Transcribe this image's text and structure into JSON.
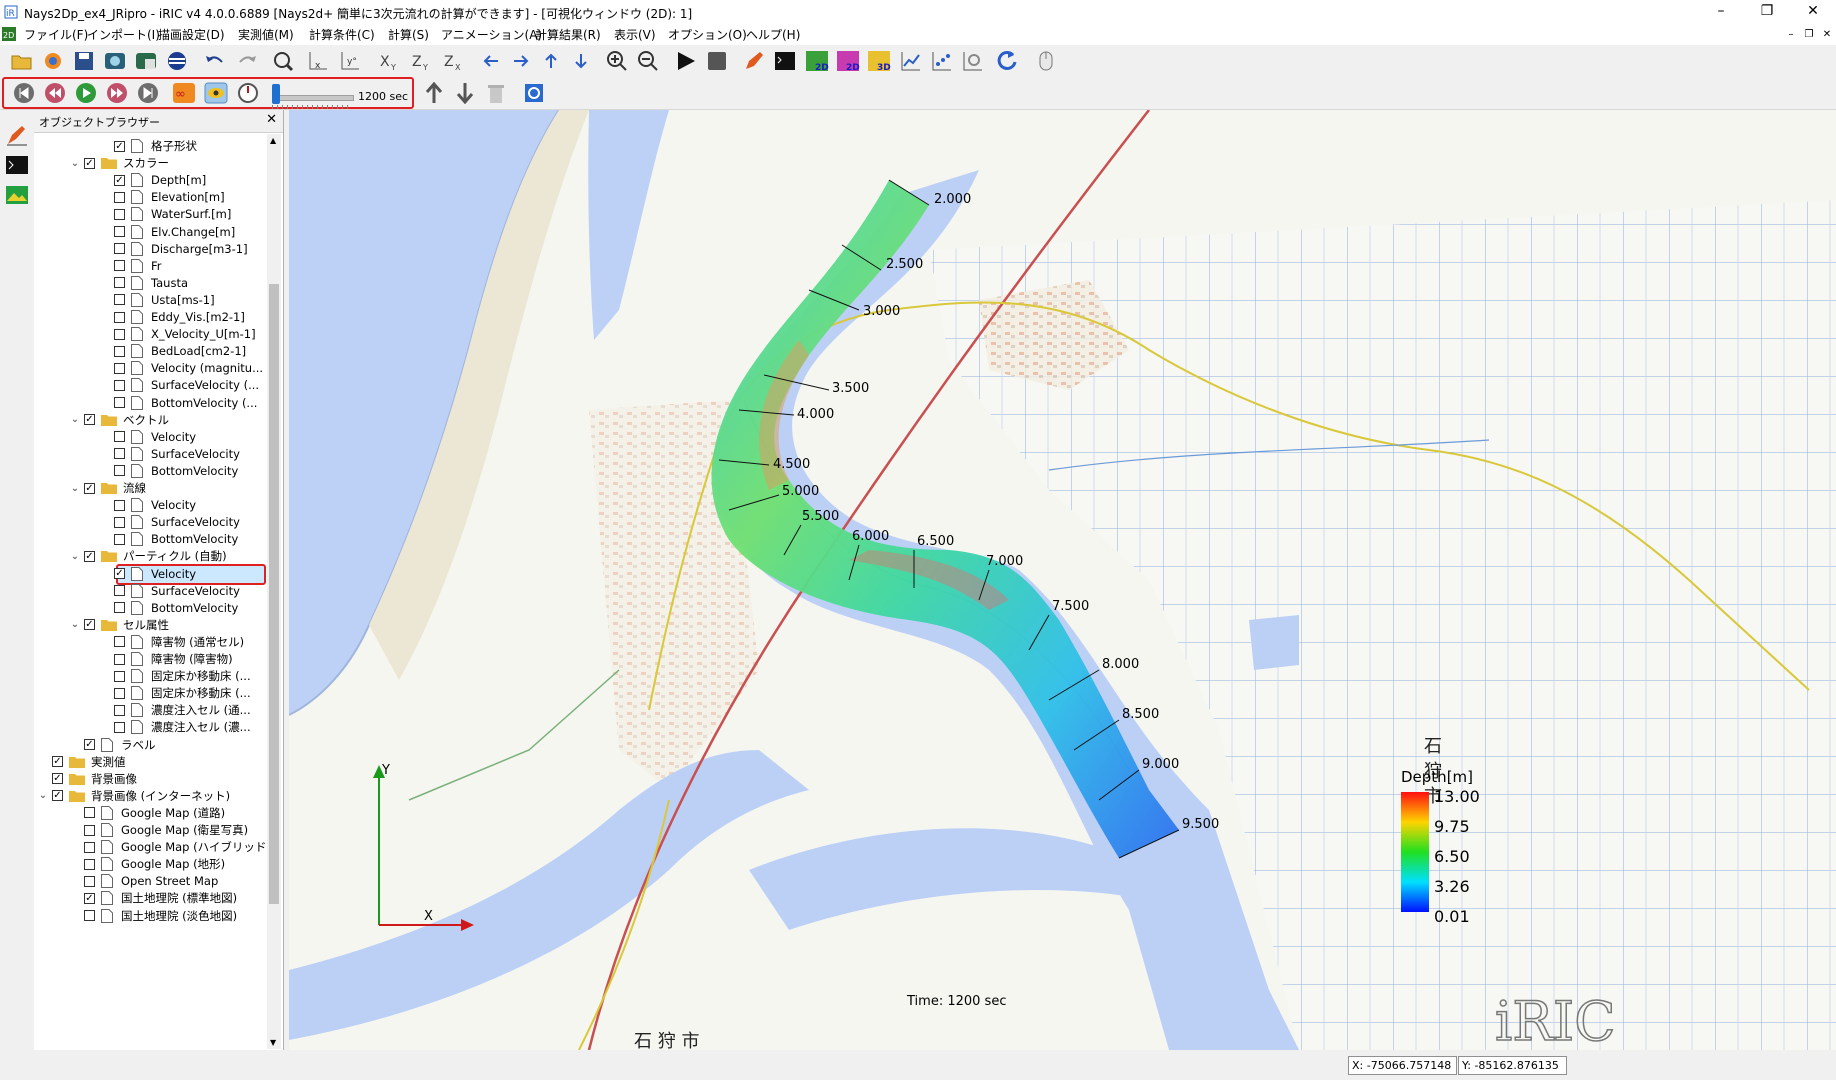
{
  "window": {
    "title": "Nays2Dp_ex4_JRipro - iRIC v4 4.0.0.6889 [Nays2d+ 簡単に3次元流れの計算ができます] - [可視化ウィンドウ (2D): 1]",
    "minimize": "–",
    "restore": "❐",
    "close": "✕"
  },
  "menu": [
    "ファイル(F)",
    "インポート(I)",
    "描画設定(D)",
    "実測値(M)",
    "計算条件(C)",
    "計算(S)",
    "アニメーション(A)",
    "計算結果(R)",
    "表示(V)",
    "オプション(O)",
    "ヘルプ(H)"
  ],
  "animation": {
    "time_label": "1200 sec",
    "progress": 0.02
  },
  "browser": {
    "title": "オブジェクトブラウザー",
    "close": "✕",
    "items": [
      {
        "label": "格子形状",
        "checked": true,
        "type": "file",
        "indent": 2,
        "expand": ""
      },
      {
        "label": "スカラー",
        "checked": true,
        "type": "folder",
        "indent": 1,
        "expand": "v"
      },
      {
        "label": "Depth[m]",
        "checked": true,
        "type": "file",
        "indent": 2,
        "expand": ""
      },
      {
        "label": "Elevation[m]",
        "checked": false,
        "type": "file",
        "indent": 2,
        "expand": ""
      },
      {
        "label": "WaterSurf.[m]",
        "checked": false,
        "type": "file",
        "indent": 2,
        "expand": ""
      },
      {
        "label": "Elv.Change[m]",
        "checked": false,
        "type": "file",
        "indent": 2,
        "expand": ""
      },
      {
        "label": "Discharge[m3-1]",
        "checked": false,
        "type": "file",
        "indent": 2,
        "expand": ""
      },
      {
        "label": "Fr",
        "checked": false,
        "type": "file",
        "indent": 2,
        "expand": ""
      },
      {
        "label": "Tausta",
        "checked": false,
        "type": "file",
        "indent": 2,
        "expand": ""
      },
      {
        "label": "Usta[ms-1]",
        "checked": false,
        "type": "file",
        "indent": 2,
        "expand": ""
      },
      {
        "label": "Eddy_Vis.[m2-1]",
        "checked": false,
        "type": "file",
        "indent": 2,
        "expand": ""
      },
      {
        "label": "X_Velocity_U[m-1]",
        "checked": false,
        "type": "file",
        "indent": 2,
        "expand": ""
      },
      {
        "label": "BedLoad[cm2-1]",
        "checked": false,
        "type": "file",
        "indent": 2,
        "expand": ""
      },
      {
        "label": "Velocity (magnitu...",
        "checked": false,
        "type": "file",
        "indent": 2,
        "expand": ""
      },
      {
        "label": "SurfaceVelocity (...",
        "checked": false,
        "type": "file",
        "indent": 2,
        "expand": ""
      },
      {
        "label": "BottomVelocity (...",
        "checked": false,
        "type": "file",
        "indent": 2,
        "expand": ""
      },
      {
        "label": "ベクトル",
        "checked": true,
        "type": "folder",
        "indent": 1,
        "expand": "v"
      },
      {
        "label": "Velocity",
        "checked": false,
        "type": "file",
        "indent": 2,
        "expand": ""
      },
      {
        "label": "SurfaceVelocity",
        "checked": false,
        "type": "file",
        "indent": 2,
        "expand": ""
      },
      {
        "label": "BottomVelocity",
        "checked": false,
        "type": "file",
        "indent": 2,
        "expand": ""
      },
      {
        "label": "流線",
        "checked": true,
        "type": "folder",
        "indent": 1,
        "expand": "v"
      },
      {
        "label": "Velocity",
        "checked": false,
        "type": "file",
        "indent": 2,
        "expand": ""
      },
      {
        "label": "SurfaceVelocity",
        "checked": false,
        "type": "file",
        "indent": 2,
        "expand": ""
      },
      {
        "label": "BottomVelocity",
        "checked": false,
        "type": "file",
        "indent": 2,
        "expand": ""
      },
      {
        "label": "パーティクル (自動)",
        "checked": true,
        "type": "folder",
        "indent": 1,
        "expand": "v"
      },
      {
        "label": "Velocity",
        "checked": true,
        "type": "file",
        "indent": 2,
        "expand": "",
        "selected": true
      },
      {
        "label": "SurfaceVelocity",
        "checked": false,
        "type": "file",
        "indent": 2,
        "expand": ""
      },
      {
        "label": "BottomVelocity",
        "checked": false,
        "type": "file",
        "indent": 2,
        "expand": ""
      },
      {
        "label": "セル属性",
        "checked": true,
        "type": "folder",
        "indent": 1,
        "expand": "v"
      },
      {
        "label": "障害物 (通常セル)",
        "checked": false,
        "type": "file",
        "indent": 2,
        "expand": ""
      },
      {
        "label": "障害物 (障害物)",
        "checked": false,
        "type": "file",
        "indent": 2,
        "expand": ""
      },
      {
        "label": "固定床か移動床 (...",
        "checked": false,
        "type": "file",
        "indent": 2,
        "expand": ""
      },
      {
        "label": "固定床か移動床 (...",
        "checked": false,
        "type": "file",
        "indent": 2,
        "expand": ""
      },
      {
        "label": "濃度注入セル (通...",
        "checked": false,
        "type": "file",
        "indent": 2,
        "expand": ""
      },
      {
        "label": "濃度注入セル (濃...",
        "checked": false,
        "type": "file",
        "indent": 2,
        "expand": ""
      },
      {
        "label": "ラベル",
        "checked": true,
        "type": "file",
        "indent": 1,
        "expand": ""
      },
      {
        "label": "実測値",
        "checked": true,
        "type": "folder",
        "indent": 0,
        "expand": ""
      },
      {
        "label": "背景画像",
        "checked": true,
        "type": "folder",
        "indent": 0,
        "expand": ""
      },
      {
        "label": "背景画像 (インターネット)",
        "checked": true,
        "type": "folder",
        "indent": 0,
        "expand": "v"
      },
      {
        "label": "Google Map (道路)",
        "checked": false,
        "type": "file",
        "indent": 1,
        "expand": ""
      },
      {
        "label": "Google Map (衛星写真)",
        "checked": false,
        "type": "file",
        "indent": 1,
        "expand": ""
      },
      {
        "label": "Google Map (ハイブリッド)",
        "checked": false,
        "type": "file",
        "indent": 1,
        "expand": ""
      },
      {
        "label": "Google Map (地形)",
        "checked": false,
        "type": "file",
        "indent": 1,
        "expand": ""
      },
      {
        "label": "Open Street Map",
        "checked": false,
        "type": "file",
        "indent": 1,
        "expand": ""
      },
      {
        "label": "国土地理院 (標準地図)",
        "checked": true,
        "type": "file",
        "indent": 1,
        "expand": ""
      },
      {
        "label": "国土地理院 (淡色地図)",
        "checked": false,
        "type": "file",
        "indent": 1,
        "expand": ""
      }
    ]
  },
  "map": {
    "stations": [
      "2.000",
      "2.500",
      "3.000",
      "3.500",
      "4.000",
      "4.500",
      "5.000",
      "5.500",
      "6.000",
      "6.500",
      "7.000",
      "7.500",
      "8.000",
      "8.500",
      "9.000",
      "9.500"
    ],
    "legend": {
      "title": "Depth[m]",
      "values": [
        "13.00",
        "9.75",
        "6.50",
        "3.26",
        "0.01"
      ]
    },
    "time_text": "Time:  1200 sec",
    "axis_x": "X",
    "axis_y": "Y",
    "city_label": [
      "石",
      "狩",
      "市"
    ],
    "bottom_label": "石  狩  市",
    "logo": "iRIC"
  },
  "status": {
    "x_coord": "X: -75066.757148",
    "y_coord": "Y: -85162.876135"
  },
  "colors": {
    "accent_red": "#e02020",
    "river_blue": "#b9ccf5",
    "selection": "#cce8ff"
  }
}
